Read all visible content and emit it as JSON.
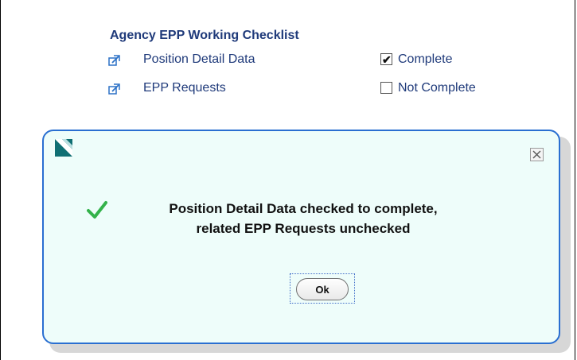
{
  "checklist": {
    "title": "Agency EPP Working Checklist",
    "items": [
      {
        "label": "Position Detail Data",
        "status_checked": true,
        "status_label": "Complete",
        "icon": "external-link-icon"
      },
      {
        "label": "EPP Requests",
        "status_checked": false,
        "status_label": "Not Complete",
        "icon": "external-link-icon"
      }
    ]
  },
  "dialog": {
    "message_line1": "Position Detail Data checked to complete,",
    "message_line2": "related EPP Requests unchecked",
    "ok_label": "Ok",
    "icons": {
      "logo": "app-logo-icon",
      "close": "close-icon",
      "success": "checkmark-icon"
    },
    "colors": {
      "border": "#2a6fd1",
      "background": "#eefdfa",
      "success": "#33b24a"
    }
  }
}
